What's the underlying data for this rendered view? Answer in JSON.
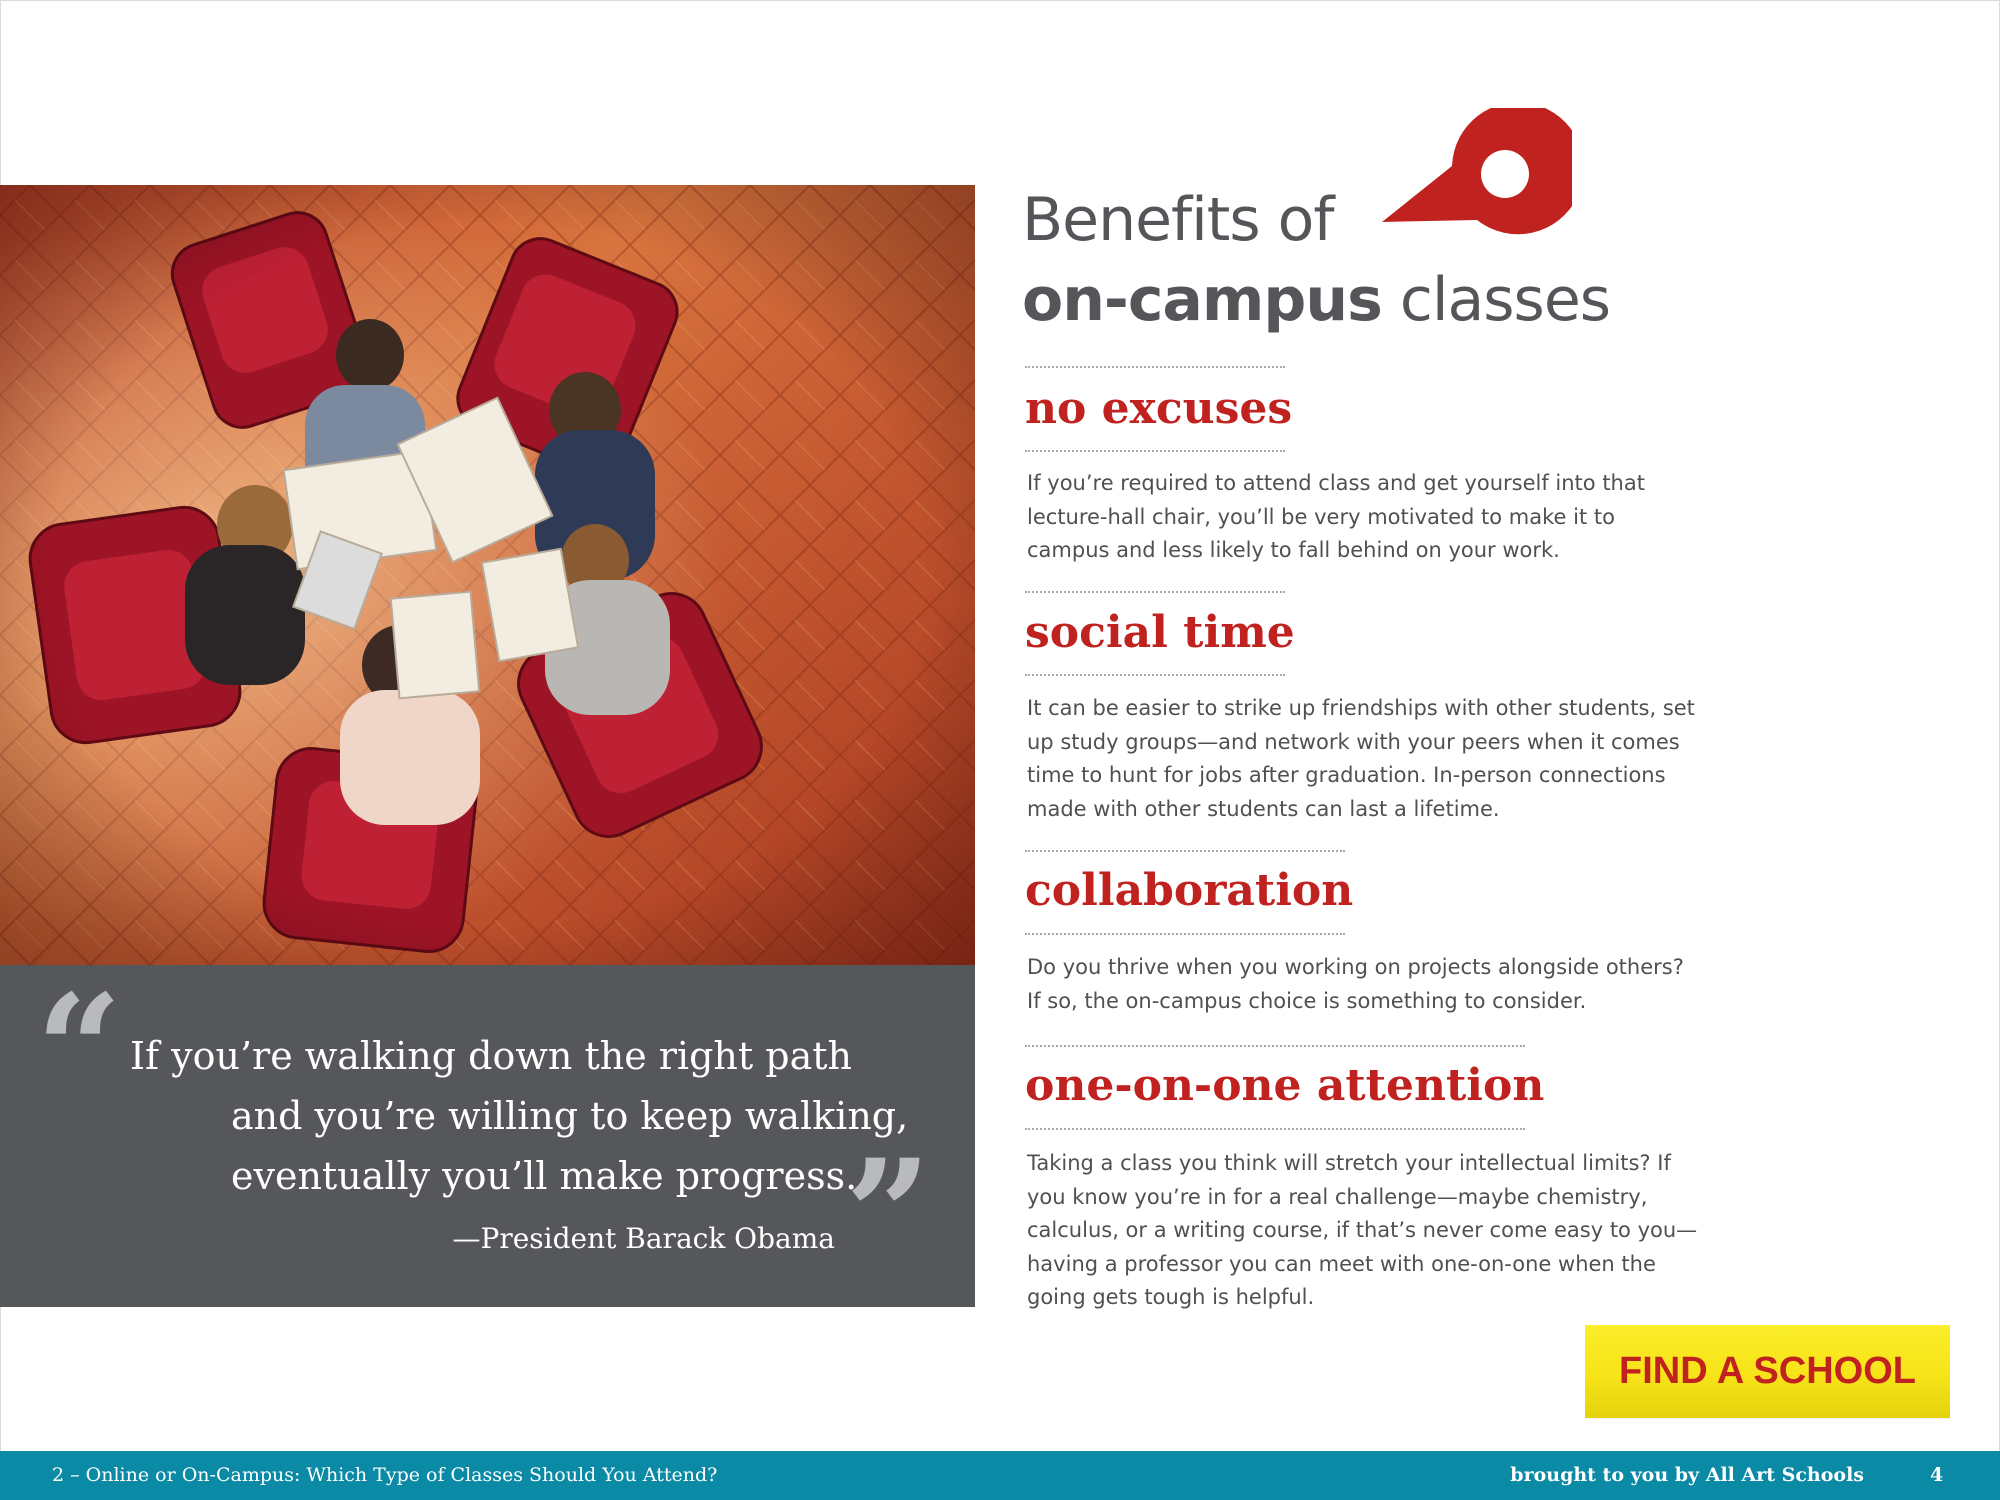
{
  "heading": {
    "line1": "Benefits of",
    "line2_bold": "on-campus",
    "line2_rest": " classes"
  },
  "benefits": [
    {
      "title": "no excuses",
      "lines": [
        "If you’re required to attend class and get yourself into that",
        "lecture-hall chair, you’ll be very motivated to make it to",
        "campus and less likely to fall behind on your work."
      ]
    },
    {
      "title": "social time",
      "lines": [
        "It can be easier to strike up friendships with other students, set",
        "up study groups—and network with your peers when it comes",
        "time to hunt for jobs after graduation. In-person connections",
        "made with other students can last a lifetime."
      ]
    },
    {
      "title": "collaboration",
      "lines": [
        "Do you thrive when you working on projects alongside others?",
        "If so, the on-campus choice is something to consider."
      ]
    },
    {
      "title": "one-on-one attention",
      "lines": [
        "Taking a class you think will stretch your intellectual limits? If",
        "you know you’re in for a real challenge—maybe chemistry,",
        "calculus, or a writing course, if that’s never come easy to you—",
        "having a professor you can meet with one-on-one when the",
        "going gets tough is helpful."
      ]
    }
  ],
  "quote": {
    "open_mark": "“",
    "close_mark": "”",
    "lines": [
      "If you’re walking down the right path",
      "and you’re willing to keep walking,",
      "eventually you’ll make progress."
    ],
    "attribution": "—President Barack Obama"
  },
  "cta": {
    "label": "FIND A SCHOOL"
  },
  "footer": {
    "left": "2 – Online or On-Campus: Which Type of Classes Should You Attend?",
    "right": "brought to you by All Art Schools",
    "page_number": "4"
  },
  "colors": {
    "accent_red": "#c0221f",
    "quote_gray": "#56575a",
    "footer_teal": "#0b8aa6",
    "cta_yellow": "#f7e318"
  },
  "icons": {
    "pin": "map-pin-icon"
  }
}
